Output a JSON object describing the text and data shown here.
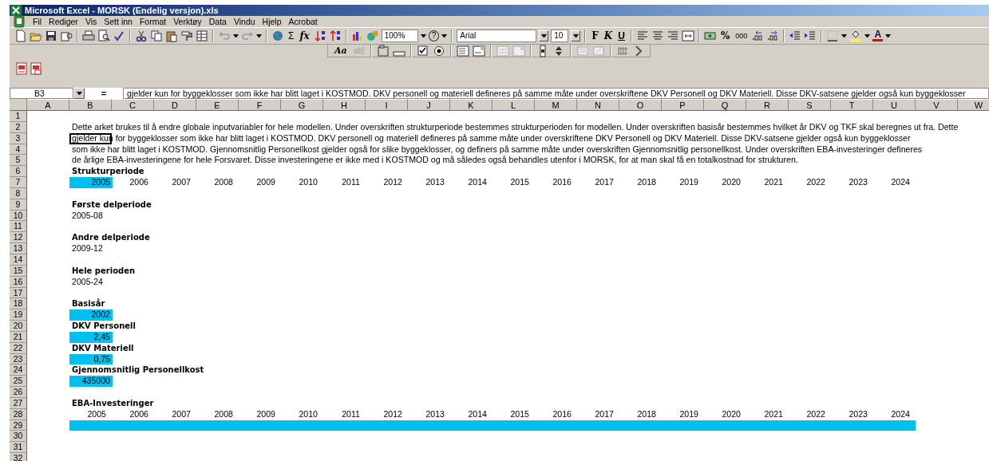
{
  "window": {
    "title": "Microsoft Excel - MORSK (Endelig versjon).xls"
  },
  "menu": [
    "Fil",
    "Rediger",
    "Vis",
    "Sett inn",
    "Format",
    "Verktøy",
    "Data",
    "Vindu",
    "Hjelp",
    "Acrobat"
  ],
  "toolbar": {
    "sum": "Σ",
    "function": "fx",
    "zoom": "100%",
    "help": "?",
    "font": "Arial",
    "font_size": "10",
    "bold": "F",
    "italic": "K",
    "underline": "U",
    "percent": "%",
    "thousands": "000",
    "font_color": "A"
  },
  "forms_toolbar": {
    "label": "Aa",
    "text_field": "ab|"
  },
  "formula_bar": {
    "name_box": "B3",
    "equals": "=",
    "formula": "gjelder kun for byggeklosser som ikke har blitt laget i KOSTMOD. DKV personell og materiell defineres på samme måte under overskriftene DKV Personell og DKV Materiell. Disse DKV-satsene gjelder også kun byggeklosser"
  },
  "sheet": {
    "columns": [
      "A",
      "B",
      "C",
      "D",
      "E",
      "F",
      "G",
      "H",
      "I",
      "J",
      "K",
      "L",
      "M",
      "N",
      "O",
      "P",
      "Q",
      "R",
      "S",
      "T",
      "U",
      "V",
      "W"
    ],
    "rows": [
      {
        "number": "1",
        "cells": []
      },
      {
        "number": "2",
        "cells": [
          {
            "kind": "blank"
          },
          {
            "kind": "text",
            "text": "Dette arket brukes til å endre globale inputvariabler for hele modellen. Under overskriften strukturperiode bestemmes strukturperioden for modellen. Under overskriften basisår bestemmes hvilket år DKV og TKF skal beregnes ut fra. Dette",
            "selected": false
          }
        ]
      },
      {
        "number": "3",
        "cells": [
          {
            "kind": "blank"
          },
          {
            "kind": "text",
            "text": "gjelder kun for byggeklosser som ikke har blitt laget i KOSTMOD. DKV personell og materiell defineres på samme måte under overskriftene DKV Personell og DKV Materiell. Disse DKV-satsene gjelder også kun byggeklosser",
            "selected": true
          }
        ]
      },
      {
        "number": "4",
        "cells": [
          {
            "kind": "blank"
          },
          {
            "kind": "text",
            "text": "som ikke har blitt laget i KOSTMOD. Gjennomsnitlig Personellkost gjelder også for slike byggeklosser, og definers på samme måte under overskriften Gjennomsnitlig personellkost. Under overskriften EBA-investeringer defineres",
            "selected": false
          }
        ]
      },
      {
        "number": "5",
        "cells": [
          {
            "kind": "blank"
          },
          {
            "kind": "text",
            "text": "de årlige EBA-investeringene for hele Forsvaret. Disse investeringene er ikke med i KOSTMOD og må således også behandles utenfor i MORSK, for at man skal få en totalkostnad for strukturen.",
            "selected": false
          }
        ]
      },
      {
        "number": "6",
        "cells": [
          {
            "kind": "blank"
          },
          {
            "kind": "heading",
            "text": "Strukturperiode",
            "selected": false
          }
        ]
      },
      {
        "number": "7",
        "cells": [
          {
            "kind": "blank"
          },
          {
            "kind": "input",
            "text": "2005",
            "selected": false
          },
          {
            "kind": "number",
            "text": "2006",
            "selected": false
          },
          {
            "kind": "number",
            "text": "2007",
            "selected": false
          },
          {
            "kind": "number",
            "text": "2008",
            "selected": false
          },
          {
            "kind": "number",
            "text": "2009",
            "selected": false
          },
          {
            "kind": "number",
            "text": "2010",
            "selected": false
          },
          {
            "kind": "number",
            "text": "2011",
            "selected": false
          },
          {
            "kind": "number",
            "text": "2012",
            "selected": false
          },
          {
            "kind": "number",
            "text": "2013",
            "selected": false
          },
          {
            "kind": "number",
            "text": "2014",
            "selected": false
          },
          {
            "kind": "number",
            "text": "2015",
            "selected": false
          },
          {
            "kind": "number",
            "text": "2016",
            "selected": false
          },
          {
            "kind": "number",
            "text": "2017",
            "selected": false
          },
          {
            "kind": "number",
            "text": "2018",
            "selected": false
          },
          {
            "kind": "number",
            "text": "2019",
            "selected": false
          },
          {
            "kind": "number",
            "text": "2020",
            "selected": false
          },
          {
            "kind": "number",
            "text": "2021",
            "selected": false
          },
          {
            "kind": "number",
            "text": "2022",
            "selected": false
          },
          {
            "kind": "number",
            "text": "2023",
            "selected": false
          },
          {
            "kind": "number",
            "text": "2024",
            "selected": false
          }
        ]
      },
      {
        "number": "8",
        "cells": []
      },
      {
        "number": "9",
        "cells": [
          {
            "kind": "blank"
          },
          {
            "kind": "heading",
            "text": "Første delperiode",
            "selected": false
          }
        ]
      },
      {
        "number": "10",
        "cells": [
          {
            "kind": "blank"
          },
          {
            "kind": "text",
            "text": "2005-08",
            "selected": false
          }
        ]
      },
      {
        "number": "11",
        "cells": []
      },
      {
        "number": "12",
        "cells": [
          {
            "kind": "blank"
          },
          {
            "kind": "heading",
            "text": "Andre delperiode",
            "selected": false
          }
        ]
      },
      {
        "number": "13",
        "cells": [
          {
            "kind": "blank"
          },
          {
            "kind": "text",
            "text": "2009-12",
            "selected": false
          }
        ]
      },
      {
        "number": "14",
        "cells": []
      },
      {
        "number": "15",
        "cells": [
          {
            "kind": "blank"
          },
          {
            "kind": "heading",
            "text": "Hele perioden",
            "selected": false
          }
        ]
      },
      {
        "number": "16",
        "cells": [
          {
            "kind": "blank"
          },
          {
            "kind": "text",
            "text": "2005-24",
            "selected": false
          }
        ]
      },
      {
        "number": "17",
        "cells": []
      },
      {
        "number": "18",
        "cells": [
          {
            "kind": "blank"
          },
          {
            "kind": "heading",
            "text": "Basisår",
            "selected": false
          }
        ]
      },
      {
        "number": "19",
        "cells": [
          {
            "kind": "blank"
          },
          {
            "kind": "input",
            "text": "2002",
            "selected": false
          }
        ]
      },
      {
        "number": "20",
        "cells": [
          {
            "kind": "blank"
          },
          {
            "kind": "heading",
            "text": "DKV Personell",
            "selected": false
          }
        ]
      },
      {
        "number": "21",
        "cells": [
          {
            "kind": "blank"
          },
          {
            "kind": "input",
            "text": "2,45",
            "selected": false
          }
        ]
      },
      {
        "number": "22",
        "cells": [
          {
            "kind": "blank"
          },
          {
            "kind": "heading",
            "text": "DKV Materiell",
            "selected": false
          }
        ]
      },
      {
        "number": "23",
        "cells": [
          {
            "kind": "blank"
          },
          {
            "kind": "input",
            "text": "0,75",
            "selected": false
          }
        ]
      },
      {
        "number": "24",
        "cells": [
          {
            "kind": "blank"
          },
          {
            "kind": "heading",
            "text": "Gjennomsnitlig Personellkost",
            "selected": false
          }
        ]
      },
      {
        "number": "25",
        "cells": [
          {
            "kind": "blank"
          },
          {
            "kind": "input",
            "text": "435000",
            "selected": false
          }
        ]
      },
      {
        "number": "26",
        "cells": []
      },
      {
        "number": "27",
        "cells": [
          {
            "kind": "blank"
          },
          {
            "kind": "heading",
            "text": "EBA-Investeringer",
            "selected": false
          }
        ]
      },
      {
        "number": "28",
        "cells": [
          {
            "kind": "blank"
          },
          {
            "kind": "number",
            "text": "2005",
            "selected": false
          },
          {
            "kind": "number",
            "text": "2006",
            "selected": false
          },
          {
            "kind": "number",
            "text": "2007",
            "selected": false
          },
          {
            "kind": "number",
            "text": "2008",
            "selected": false
          },
          {
            "kind": "number",
            "text": "2009",
            "selected": false
          },
          {
            "kind": "number",
            "text": "2010",
            "selected": false
          },
          {
            "kind": "number",
            "text": "2011",
            "selected": false
          },
          {
            "kind": "number",
            "text": "2012",
            "selected": false
          },
          {
            "kind": "number",
            "text": "2013",
            "selected": false
          },
          {
            "kind": "number",
            "text": "2014",
            "selected": false
          },
          {
            "kind": "number",
            "text": "2015",
            "selected": false
          },
          {
            "kind": "number",
            "text": "2016",
            "selected": false
          },
          {
            "kind": "number",
            "text": "2017",
            "selected": false
          },
          {
            "kind": "number",
            "text": "2018",
            "selected": false
          },
          {
            "kind": "number",
            "text": "2019",
            "selected": false
          },
          {
            "kind": "number",
            "text": "2020",
            "selected": false
          },
          {
            "kind": "number",
            "text": "2021",
            "selected": false
          },
          {
            "kind": "number",
            "text": "2022",
            "selected": false
          },
          {
            "kind": "number",
            "text": "2023",
            "selected": false
          },
          {
            "kind": "number",
            "text": "2024",
            "selected": false
          }
        ]
      },
      {
        "number": "29",
        "cells": [
          {
            "kind": "blank"
          },
          {
            "kind": "input_band",
            "selected": false
          }
        ]
      },
      {
        "number": "30",
        "cells": []
      },
      {
        "number": "31",
        "cells": []
      },
      {
        "number": "32",
        "cells": []
      }
    ]
  }
}
